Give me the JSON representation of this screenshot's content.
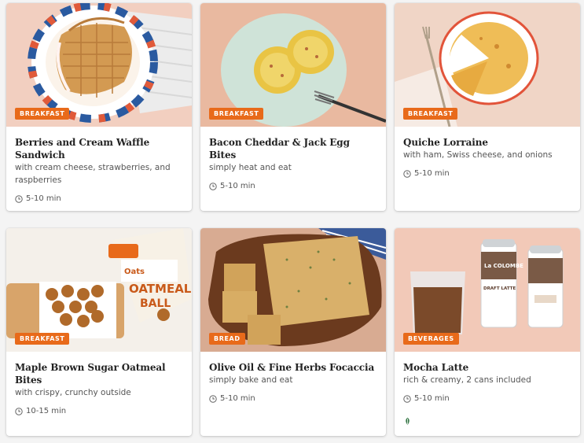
{
  "colors": {
    "badge": "#e86a1a",
    "page_bg": "#f4f4f4",
    "card_bg": "#ffffff"
  },
  "cards": [
    {
      "category": "BREAKFAST",
      "title": "Berries and Cream Waffle Sandwich",
      "description": "with cream cheese, strawberries, and raspberries",
      "time": "5-10 min",
      "image": "waffle-sandwich-image"
    },
    {
      "category": "BREAKFAST",
      "title": "Bacon Cheddar & Jack Egg Bites",
      "description": "simply heat and eat",
      "time": "5-10 min",
      "image": "egg-bites-image"
    },
    {
      "category": "BREAKFAST",
      "title": "Quiche Lorraine",
      "description": "with ham, Swiss cheese, and onions",
      "time": "5-10 min",
      "image": "quiche-image"
    },
    {
      "category": "BREAKFAST",
      "title": "Maple Brown Sugar Oatmeal Bites",
      "description": "with crispy, crunchy outside",
      "time": "10-15 min",
      "image": "oatmeal-bites-image"
    },
    {
      "category": "BREAD",
      "title": "Olive Oil & Fine Herbs Focaccia",
      "description": "simply bake and eat",
      "time": "5-10 min",
      "image": "focaccia-image"
    },
    {
      "category": "BEVERAGES",
      "title": "Mocha Latte",
      "description": "rich & creamy, 2 cans included",
      "time": "5-10 min",
      "image": "mocha-latte-image",
      "badge_icon": "leaf-icon"
    }
  ],
  "product_text": {
    "oats_brand": "Oats",
    "oats_label": "OATMEAL",
    "oats_label2": "BALL",
    "can_brand": "La COLOMBE",
    "can_flavor": "DRAFT LATTE"
  }
}
